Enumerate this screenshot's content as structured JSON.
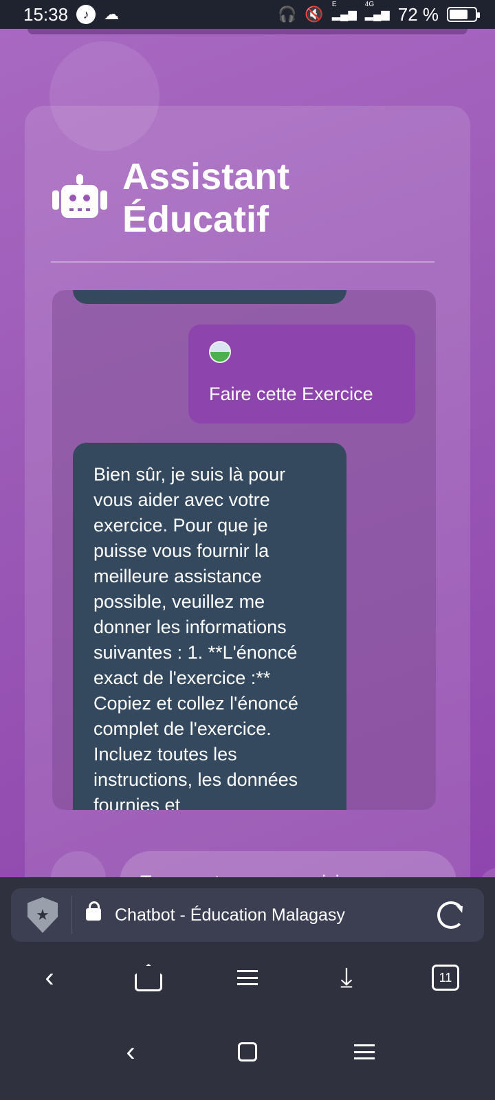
{
  "status_bar": {
    "time": "15:38",
    "battery_text": "72 %",
    "battery_level": 0.72,
    "network_labels": [
      "E",
      "4G"
    ],
    "icons": [
      "music-note-icon",
      "cloud-icon",
      "headphones-icon",
      "mute-icon",
      "signal-icon",
      "signal-icon",
      "battery-icon"
    ]
  },
  "app": {
    "title_line1": "Assistant",
    "title_line2": "Éducatif",
    "icon": "robot-icon"
  },
  "chat": {
    "messages": [
      {
        "role": "user",
        "has_image": true,
        "text": "Faire cette Exercice"
      },
      {
        "role": "assistant",
        "text": "Bien sûr, je suis là pour vous aider avec votre exercice. Pour que je puisse vous fournir la meilleure assistance possible, veuillez me donner les informations suivantes : 1. **L'énoncé exact de l'exercice :** Copiez et collez l'énoncé complet de l'exercice. Incluez toutes les instructions, les données fournies et"
      }
    ]
  },
  "input": {
    "placeholder_partial": "Tapez votre message ici..."
  },
  "browser": {
    "page_title": "Chatbot - Éducation Malagasy",
    "tab_count": "11",
    "colors": {
      "bar": "#2f313f",
      "url_field": "#3c3f52"
    }
  },
  "theme": {
    "background": "#9b59b6",
    "user_bubble": "#8e44ad",
    "bot_bubble": "#34495e"
  }
}
